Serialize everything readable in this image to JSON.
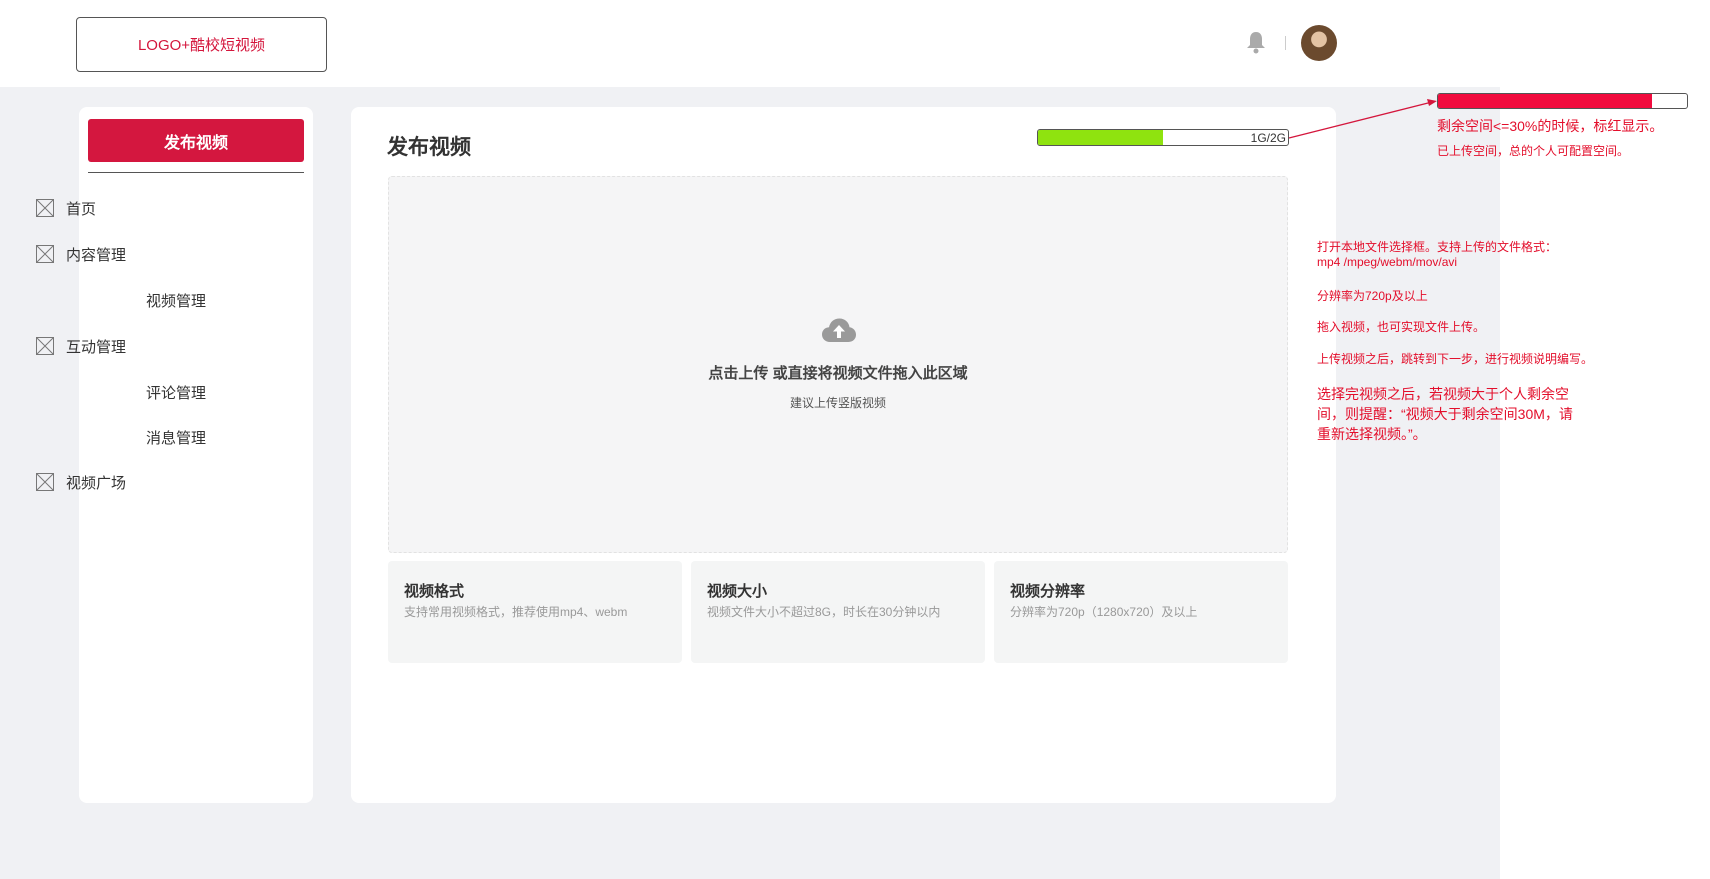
{
  "header": {
    "logo_text": "LOGO+酷校短视频",
    "icons": {
      "notification": "bell-icon",
      "user": "avatar"
    }
  },
  "sidebar": {
    "publish_label": "发布视频",
    "items": [
      {
        "label": "首页",
        "icon": "image-placeholder-icon"
      },
      {
        "label": "内容管理",
        "icon": "image-placeholder-icon"
      },
      {
        "label": "视频管理",
        "icon": ""
      },
      {
        "label": "互动管理",
        "icon": "image-placeholder-icon"
      },
      {
        "label": "评论管理",
        "icon": ""
      },
      {
        "label": "消息管理",
        "icon": ""
      },
      {
        "label": "视频广场",
        "icon": "image-placeholder-icon"
      }
    ]
  },
  "main": {
    "title": "发布视频",
    "storage": {
      "text": "1G/2G",
      "used_fraction": 0.5,
      "fill_color": "#8fe30f"
    },
    "dropzone": {
      "icon": "cloud-upload-icon",
      "main_text": "点击上传 或直接将视频文件拖入此区域",
      "sub_text": "建议上传竖版视频"
    },
    "info_cards": [
      {
        "title": "视频格式",
        "desc": "支持常用视频格式，推荐使用mp4、webm"
      },
      {
        "title": "视频大小",
        "desc": "视频文件大小不超过8G，时长在30分钟以内"
      },
      {
        "title": "视频分辨率",
        "desc": "分辨率为720p（1280x720）及以上"
      }
    ]
  },
  "annotations": {
    "storage_bar": {
      "used_fraction": 0.86,
      "fill_color": "#f10c3e"
    },
    "storage_note_1": "剩余空间<=30%的时候，标红显示。",
    "storage_note_2": "已上传空间，总的个人可配置空间。",
    "upload_note_1a": "打开本地文件选择框。支持上传的文件格式：",
    "upload_note_1b": "mp4 /mpeg/webm/mov/avi",
    "upload_note_2": "分辨率为720p及以上",
    "upload_note_3": "拖入视频，也可实现文件上传。",
    "upload_note_4": "上传视频之后，跳转到下一步，进行视频说明编写。",
    "upload_note_5a": "选择完视频之后，若视频大于个人剩余空",
    "upload_note_5b": "间，则提醒：“视频大于剩余空间30M，请",
    "upload_note_5c": "重新选择视频。”。"
  },
  "colors": {
    "brand_red": "#d4173f",
    "annotation_red": "#e30e2b",
    "workspace_bg": "#f0f1f4"
  }
}
